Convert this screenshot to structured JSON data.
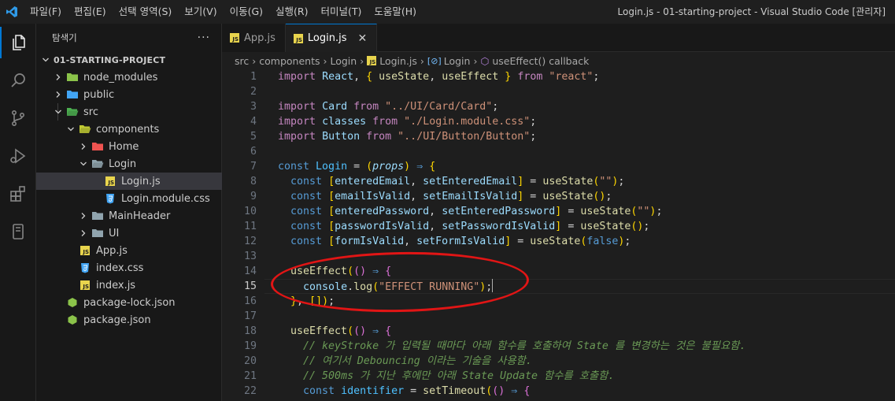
{
  "window": {
    "title": "Login.js - 01-starting-project - Visual Studio Code [관리자]",
    "menu": [
      "파일(F)",
      "편집(E)",
      "선택 영역(S)",
      "보기(V)",
      "이동(G)",
      "실행(R)",
      "터미널(T)",
      "도움말(H)"
    ]
  },
  "sidebar": {
    "title": "탐색기",
    "more": "···",
    "project": "01-STARTING-PROJECT",
    "items": [
      {
        "label": "node_modules",
        "kind": "folder",
        "icon": "node-folder-icon",
        "color": "#8bc34a"
      },
      {
        "label": "public",
        "kind": "folder",
        "icon": "globe-folder-icon",
        "color": "#42a5f5"
      },
      {
        "label": "src",
        "kind": "folder-open",
        "icon": "src-folder-icon",
        "color": "#4caf50"
      },
      {
        "label": "components",
        "kind": "folder-open",
        "icon": "components-folder-icon",
        "color": "#c0ca33"
      },
      {
        "label": "Home",
        "kind": "folder",
        "icon": "home-folder-icon",
        "color": "#ef5350"
      },
      {
        "label": "Login",
        "kind": "folder-open",
        "icon": "folder-icon",
        "color": "#90a4ae"
      },
      {
        "label": "Login.js",
        "kind": "file",
        "icon": "js-file-icon",
        "color": "#e8d44d"
      },
      {
        "label": "Login.module.css",
        "kind": "file",
        "icon": "css-file-icon",
        "color": "#42a5f5"
      },
      {
        "label": "MainHeader",
        "kind": "folder",
        "icon": "folder-icon",
        "color": "#90a4ae"
      },
      {
        "label": "UI",
        "kind": "folder",
        "icon": "folder-icon",
        "color": "#90a4ae"
      },
      {
        "label": "App.js",
        "kind": "file",
        "icon": "js-file-icon",
        "color": "#e8d44d"
      },
      {
        "label": "index.css",
        "kind": "file",
        "icon": "css-file-icon",
        "color": "#42a5f5"
      },
      {
        "label": "index.js",
        "kind": "file",
        "icon": "js-file-icon",
        "color": "#e8d44d"
      },
      {
        "label": "package-lock.json",
        "kind": "file",
        "icon": "npm-file-icon",
        "color": "#8bc34a"
      },
      {
        "label": "package.json",
        "kind": "file",
        "icon": "npm-file-icon",
        "color": "#8bc34a"
      }
    ]
  },
  "tabs": [
    {
      "label": "App.js",
      "active": false
    },
    {
      "label": "Login.js",
      "active": true,
      "close": "✕"
    }
  ],
  "breadcrumb": [
    "src",
    "components",
    "Login",
    "Login.js",
    "Login",
    "useEffect() callback"
  ],
  "editor": {
    "current_line": 15,
    "lines": [
      {
        "n": "1",
        "text": "import React, { useState, useEffect } from \"react\";"
      },
      {
        "n": "2",
        "text": ""
      },
      {
        "n": "3",
        "text": "import Card from \"../UI/Card/Card\";"
      },
      {
        "n": "4",
        "text": "import classes from \"./Login.module.css\";"
      },
      {
        "n": "5",
        "text": "import Button from \"../UI/Button/Button\";"
      },
      {
        "n": "6",
        "text": ""
      },
      {
        "n": "7",
        "text": "const Login = (props) => {"
      },
      {
        "n": "8",
        "text": "  const [enteredEmail, setEnteredEmail] = useState(\"\");"
      },
      {
        "n": "9",
        "text": "  const [emailIsValid, setEmailIsValid] = useState();"
      },
      {
        "n": "10",
        "text": "  const [enteredPassword, setEnteredPassword] = useState(\"\");"
      },
      {
        "n": "11",
        "text": "  const [passwordIsValid, setPasswordIsValid] = useState();"
      },
      {
        "n": "12",
        "text": "  const [formIsValid, setFormIsValid] = useState(false);"
      },
      {
        "n": "13",
        "text": ""
      },
      {
        "n": "14",
        "text": "  useEffect(() => {"
      },
      {
        "n": "15",
        "text": "    console.log(\"EFFECT RUNNING\");"
      },
      {
        "n": "16",
        "text": "  }, []);"
      },
      {
        "n": "17",
        "text": ""
      },
      {
        "n": "18",
        "text": "  useEffect(() => {"
      },
      {
        "n": "19",
        "text": "    // keyStroke 가 입력될 때마다 아래 함수를 호출하여 State 를 변경하는 것은 불필요함."
      },
      {
        "n": "20",
        "text": "    // 여기서 Debouncing 이라는 기술을 사용함."
      },
      {
        "n": "21",
        "text": "    // 500ms 가 지난 후에만 아래 State Update 함수를 호출함."
      },
      {
        "n": "22",
        "text": "    const identifier = setTimeout(() => {"
      }
    ]
  },
  "colors": {
    "accent": "#0078d4",
    "annotation": "#e11515"
  }
}
